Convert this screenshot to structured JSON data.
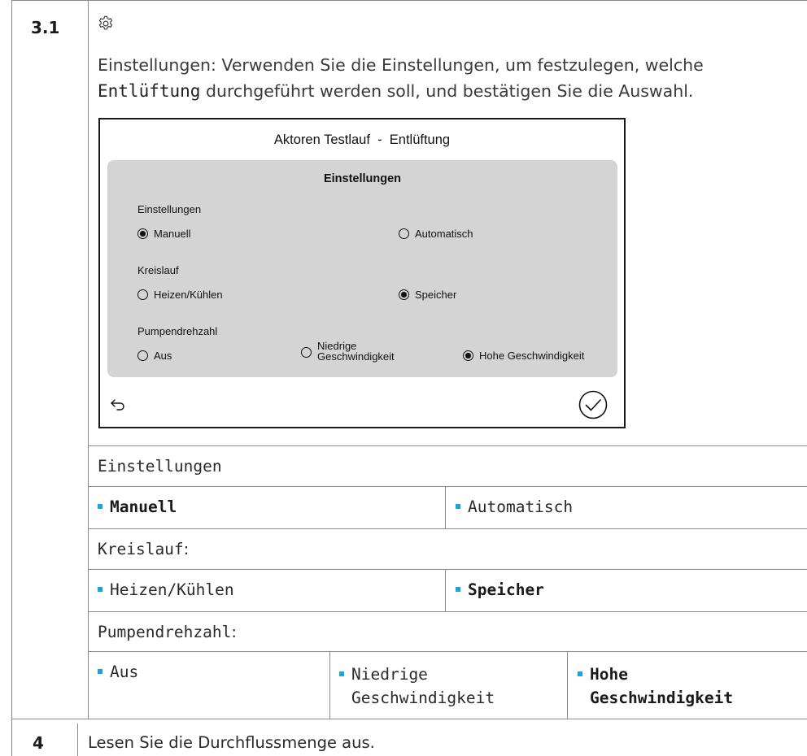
{
  "step_3_1": {
    "number": "3.1",
    "icon": "gear-icon",
    "intro_before": "Einstellungen: Verwenden Sie die Einstellungen, um festzulegen, welche ",
    "intro_code": "Entlüftung",
    "intro_after": " durchgeführt werden soll, und bestätigen Sie die Auswahl.",
    "screen": {
      "title": "Aktoren Testlauf  -  Entlüftung",
      "panel_title": "Einstellungen",
      "groups": [
        {
          "label": "Einstellungen",
          "options": [
            {
              "label": "Manuell",
              "selected": true
            },
            {
              "label": "Automatisch",
              "selected": false
            }
          ]
        },
        {
          "label": "Kreislauf",
          "options": [
            {
              "label": "Heizen/Kühlen",
              "selected": false
            },
            {
              "label": "Speicher",
              "selected": true
            }
          ]
        },
        {
          "label": "Pumpendrehzahl",
          "options": [
            {
              "label": "Aus",
              "selected": false
            },
            {
              "label_line1": "Niedrige",
              "label_line2": "Geschwindigkeit",
              "selected": false
            },
            {
              "label": "Hohe Geschwindigkeit",
              "selected": true
            }
          ]
        }
      ],
      "back_icon": "back-arrow-icon",
      "confirm_icon": "checkmark-circle-icon"
    },
    "table": {
      "settings_header": "Einstellungen",
      "settings_options": [
        "Manuell",
        "Automatisch"
      ],
      "circuit_header": "Kreislauf",
      "circuit_colon": ":",
      "circuit_options": [
        "Heizen/Kühlen",
        "Speicher"
      ],
      "pump_header": "Pumpendrehzahl",
      "pump_colon": ":",
      "pump_options": [
        {
          "line1": "Aus",
          "line2": ""
        },
        {
          "line1": "Niedrige",
          "line2": "Geschwindigkeit"
        },
        {
          "line1": "Hohe",
          "line2": "Geschwindigkeit"
        }
      ]
    }
  },
  "step_4": {
    "number": "4",
    "text": "Lesen Sie die Durchflussmenge aus."
  },
  "colors": {
    "bullet": "#1aa3e0",
    "panel_bg": "#d4d4d4",
    "border": "#8a8a8a"
  }
}
